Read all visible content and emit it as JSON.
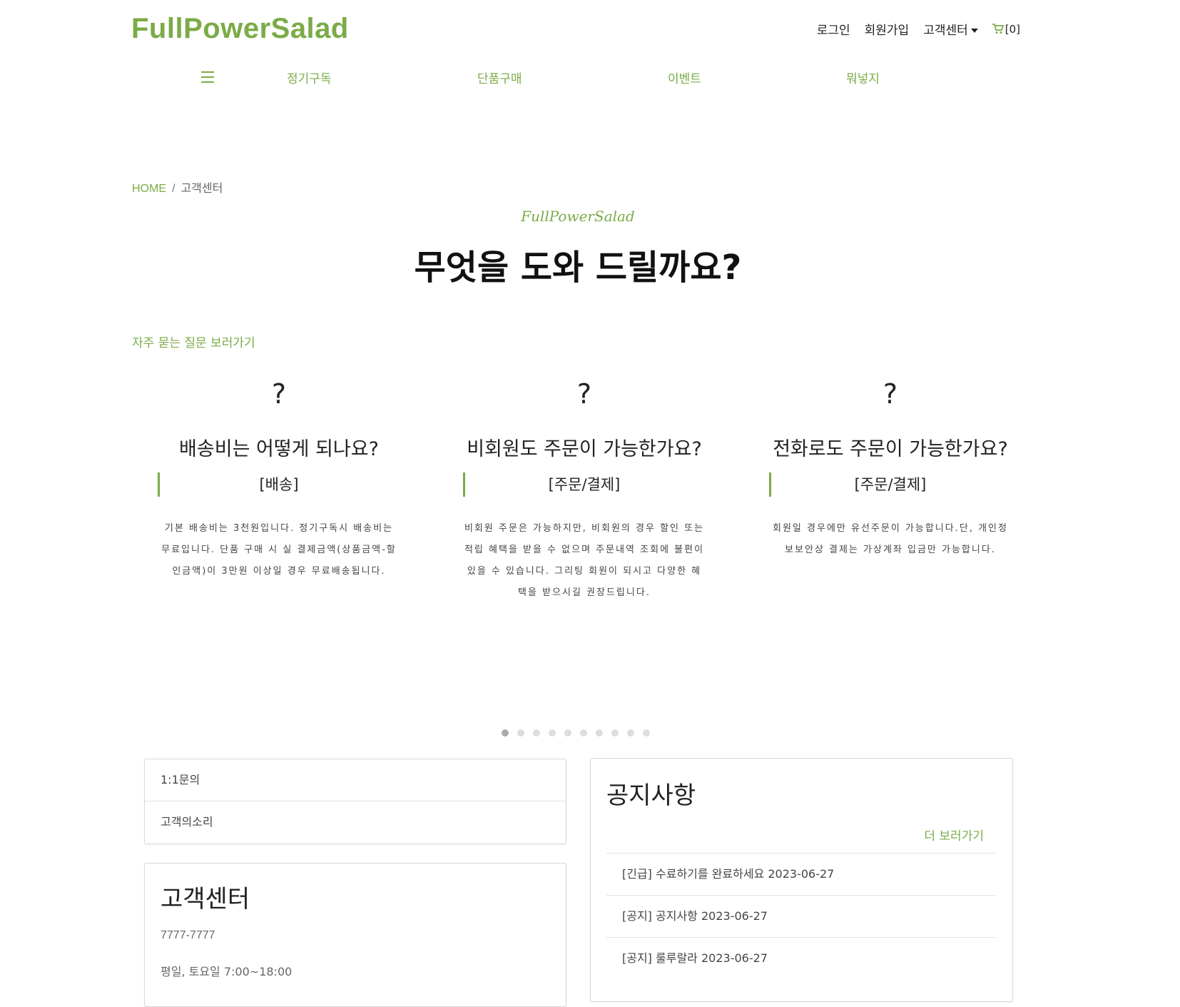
{
  "header": {
    "logo": "FullPowerSalad",
    "top_links": {
      "login": "로그인",
      "signup": "회원가입",
      "support": "고객센터",
      "cart": "[0]"
    },
    "nav": {
      "subscription": "정기구독",
      "single": "단품구매",
      "event": "이벤트",
      "newsletter": "뭐넣지"
    }
  },
  "breadcrumb": {
    "home": "HOME",
    "separator": "/",
    "current": "고객센터"
  },
  "hero": {
    "brand": "FullPowerSalad",
    "title": "무엇을 도와 드릴까요?"
  },
  "faq": {
    "link": "자주 묻는 질문 보러가기",
    "items": [
      {
        "icon": "?",
        "question": "배송비는 어떻게 되나요?",
        "category": "[배송]",
        "answer": "기본 배송비는 3천원입니다. 정기구독시 배송비는 무료입니다. 단품 구매 시 실 결제금액(상품금액-할인금액)이 3만원 이상일 경우 무료배송됩니다."
      },
      {
        "icon": "?",
        "question": "비회원도 주문이 가능한가요?",
        "category": "[주문/결제]",
        "answer": "비회원 주문은 가능하지만, 비회원의 경우 할인 또는 적립 혜택을 받을 수 없으며 주문내역 조회에 불편이 있을 수 있습니다. 그리팅 회원이 되시고 다양한 혜택을 받으시길 권장드립니다."
      },
      {
        "icon": "?",
        "question": "전화로도 주문이 가능한가요?",
        "category": "[주문/결제]",
        "answer": "회원일 경우에만 유선주문이 가능합니다.단, 개인정보보안상 결제는 가상계좌 입금만 가능합니다."
      }
    ],
    "carousel": {
      "total": 10,
      "active": 1
    }
  },
  "quick_links": {
    "inquiry": "1:1문의",
    "voice": "고객의소리"
  },
  "customer_center": {
    "title": "고객센터",
    "phone": "7777-7777",
    "hours": "평일, 토요일 7:00~18:00"
  },
  "notice": {
    "title": "공지사항",
    "more": "더 보러가기",
    "items": [
      {
        "text": "[긴급] 수료하기를 완료하세요 2023-06-27"
      },
      {
        "text": "[공지] 공지사항 2023-06-27"
      },
      {
        "text": "[공지] 룰루랄라 2023-06-27"
      }
    ]
  },
  "colors": {
    "accent": "#7bab47",
    "text": "#222222"
  }
}
